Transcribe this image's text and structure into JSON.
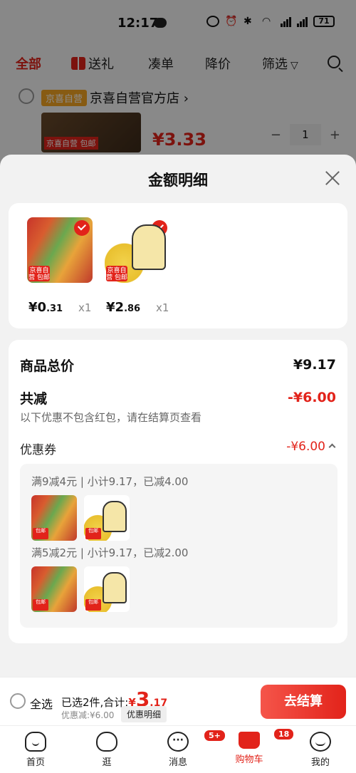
{
  "status_bar": {
    "time": "12:17",
    "battery": "71"
  },
  "tabs": [
    {
      "label": "全部"
    },
    {
      "label": "送礼"
    },
    {
      "label": "凑单"
    },
    {
      "label": "降价"
    },
    {
      "label": "筛选"
    }
  ],
  "background": {
    "store_badge": "京喜自营",
    "store_name": "京喜自营官方店 ›",
    "thumb_tag": "京喜自营 包邮",
    "price": "¥3.33",
    "quantity": "1"
  },
  "sheet": {
    "title": "金额明细",
    "items": [
      {
        "badge": "京喜自营 包邮",
        "price_int": "¥0",
        "price_dec": ".31",
        "qty": "x1"
      },
      {
        "badge": "京喜自营 包邮",
        "price_int": "¥2",
        "price_dec": ".86",
        "qty": "x1"
      }
    ],
    "total_label": "商品总价",
    "total_value": "¥9.17",
    "reduce_label": "共减",
    "reduce_value": "-¥6.00",
    "reduce_note": "以下优惠不包含红包，请在结算页查看",
    "coupon_label": "优惠券",
    "coupon_value": "-¥6.00",
    "rules": [
      {
        "text": "满9减4元 | 小计9.17，已减4.00"
      },
      {
        "text": "满5减2元 | 小计9.17，已减2.00"
      }
    ]
  },
  "checkout": {
    "select_all": "全选",
    "summary_prefix": "已选2件,合计:",
    "price_cur": "¥",
    "price_int": "3",
    "price_dec": ".17",
    "discount": "优惠减:¥6.00",
    "detail_button": "优惠明细",
    "pay_button": "去结算"
  },
  "bottom_nav": [
    {
      "label": "首页"
    },
    {
      "label": "逛"
    },
    {
      "label": "消息",
      "badge": "5+"
    },
    {
      "label": "购物车",
      "badge": "18"
    },
    {
      "label": "我的"
    }
  ],
  "colors": {
    "accent": "#e2231a"
  }
}
